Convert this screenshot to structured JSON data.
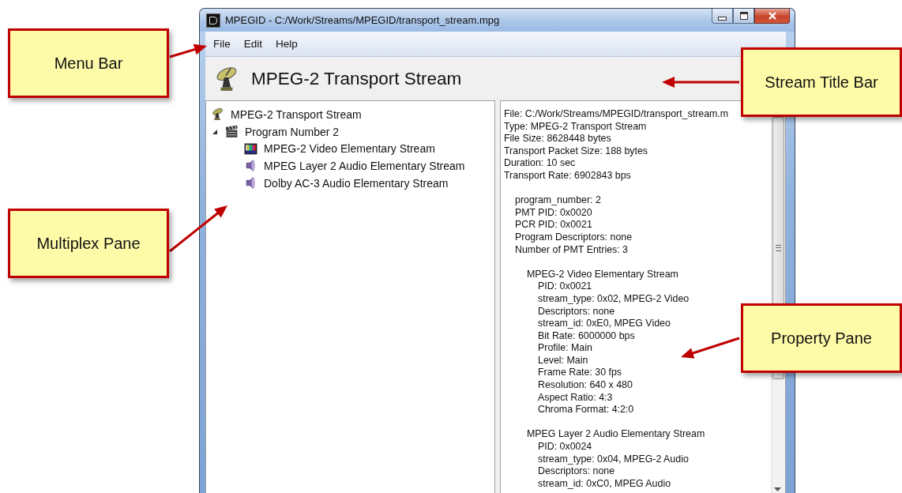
{
  "window": {
    "title": "MPEGID - C:/Work/Streams/MPEGID/transport_stream.mpg"
  },
  "menu": [
    "File",
    "Edit",
    "Help"
  ],
  "stream_title": "MPEG-2 Transport Stream",
  "multiplex_tree": [
    {
      "label": "MPEG-2 Transport Stream",
      "kind": "transport",
      "children": [
        {
          "label": "Program Number 2",
          "kind": "program",
          "expanded": true,
          "children": [
            {
              "label": "MPEG-2 Video Elementary Stream",
              "kind": "video"
            },
            {
              "label": "MPEG Layer 2 Audio Elementary Stream",
              "kind": "audio"
            },
            {
              "label": "Dolby AC-3 Audio Elementary Stream",
              "kind": "audio"
            }
          ]
        }
      ]
    }
  ],
  "property_pane": {
    "file_info": [
      "File: C:/Work/Streams/MPEGID/transport_stream.m",
      "Type: MPEG-2 Transport Stream",
      "File Size: 8628448 bytes",
      "Transport Packet Size: 188 bytes",
      "Duration: 10 sec",
      "Transport Rate: 6902843 bps"
    ],
    "program_info": [
      "program_number: 2",
      "PMT PID: 0x0020",
      "PCR PID: 0x0021",
      "Program Descriptors: none",
      "Number of PMT Entries: 3"
    ],
    "streams": [
      {
        "name": "MPEG-2 Video Elementary Stream",
        "properties": [
          "PID: 0x0021",
          "stream_type: 0x02, MPEG-2 Video",
          "Descriptors: none",
          "stream_id: 0xE0, MPEG Video",
          "Bit Rate: 6000000 bps",
          "Profile: Main",
          "Level: Main",
          "Frame Rate: 30 fps",
          "Resolution: 640 x 480",
          "Aspect Ratio: 4:3",
          "Chroma Format: 4:2:0"
        ]
      },
      {
        "name": "MPEG Layer 2 Audio Elementary Stream",
        "properties": [
          "PID: 0x0024",
          "stream_type: 0x04, MPEG-2 Audio",
          "Descriptors: none",
          "stream_id: 0xC0, MPEG Audio"
        ]
      }
    ]
  },
  "annotations": [
    {
      "label": "Menu Bar"
    },
    {
      "label": "Multiplex Pane"
    },
    {
      "label": "Stream Title Bar"
    },
    {
      "label": "Property Pane"
    }
  ]
}
